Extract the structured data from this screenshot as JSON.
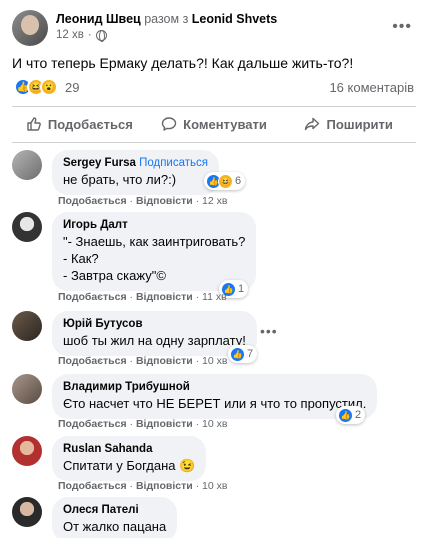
{
  "post": {
    "author": "Леонид Швец",
    "with_word": "разом з",
    "coauthor": "Leonid Shvets",
    "time": "12 хв",
    "text": "И что теперь Ермаку делать?! Как дальше жить-то?!",
    "reaction_count": "29",
    "comment_count": "16 коментарів"
  },
  "actions": {
    "like": "Подобається",
    "comment": "Коментувати",
    "share": "Поширити"
  },
  "comments": [
    {
      "name": "Sergey Fursa",
      "follow": "Подписаться",
      "lines": [
        "не брать, что ли?:)"
      ],
      "meta": [
        "Подобається",
        "Відповісти",
        "12 хв"
      ],
      "reactions": "6"
    },
    {
      "name": "Игорь Далт",
      "lines": [
        "\"- Знаешь, как заинтриговать?",
        "- Как?",
        "- Завтра скажу\"©"
      ],
      "meta": [
        "Подобається",
        "Відповісти",
        "11 хв"
      ],
      "reactions": "1"
    },
    {
      "name": "Юрій Бутусов",
      "lines": [
        "шоб ты жил на одну зарплату!"
      ],
      "meta": [
        "Подобається",
        "Відповісти",
        "10 хв"
      ],
      "reactions": "7"
    },
    {
      "name": "Владимир Трибушной",
      "lines": [
        "Єто насчет что НЕ БЕРЕТ или я что то пропустил."
      ],
      "meta": [
        "Подобається",
        "Відповісти",
        "10 хв"
      ],
      "reactions": "2"
    },
    {
      "name": "Ruslan Sahanda",
      "lines": [
        "Спитати у Богдана"
      ],
      "meta": [
        "Подобається",
        "Відповісти",
        "10 хв"
      ]
    },
    {
      "name": "Олеся Пателі",
      "lines": [
        "От жалко пацана"
      ]
    }
  ],
  "separator": "·",
  "colors": {
    "accent": "#1877f2",
    "muted": "#65676b",
    "bubble": "#f0f2f5"
  }
}
